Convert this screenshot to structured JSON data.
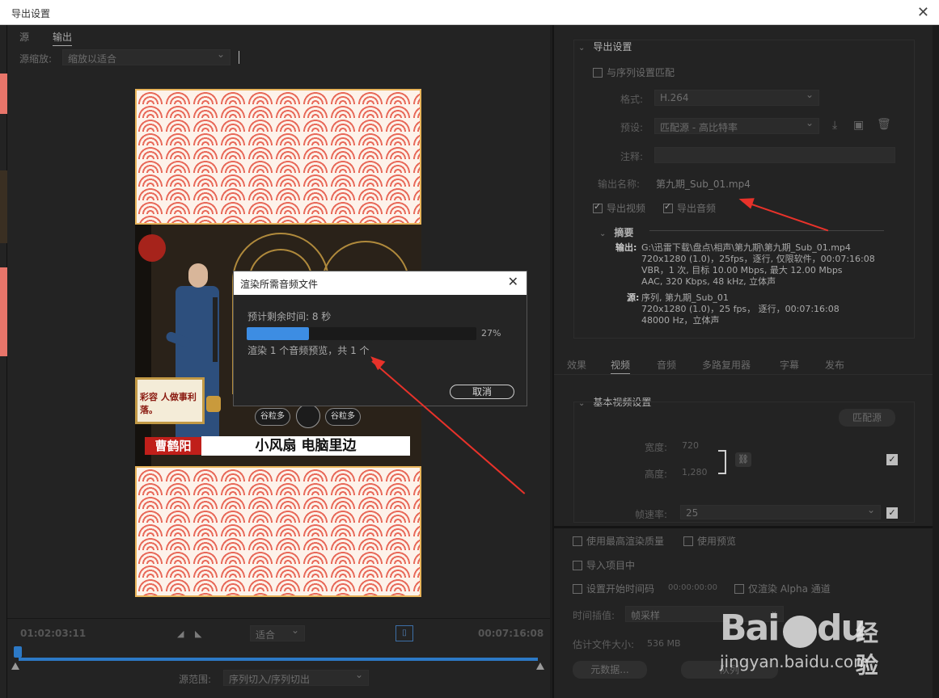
{
  "window": {
    "title": "导出设置",
    "close_glyph": "✕"
  },
  "left": {
    "tabs": [
      "源",
      "输出"
    ],
    "scale_label": "源缩放:",
    "scale_value": "缩放以适合",
    "video": {
      "sign_text": "彩容 人做事利落。",
      "banner_name": "曹鹤阳",
      "banner_title": "小风扇 电脑里边",
      "candy_left": "谷粒多",
      "candy_right": "谷粒多"
    }
  },
  "dialog": {
    "title": "渲染所需音频文件",
    "close_glyph": "✕",
    "remaining": "预计剩余时间: 8 秒",
    "progress": 0.27,
    "progress_label": "27%",
    "message": "渲染 1 个音频预览，共 1 个",
    "cancel": "取消"
  },
  "timeline": {
    "current_tc": "01:02:03:11",
    "end_tc": "00:07:16:08",
    "fit": "适合",
    "range_label": "源范围:",
    "range_value": "序列切入/序列切出"
  },
  "export": {
    "section_title": "导出设置",
    "match_sequence": "与序列设置匹配",
    "format_label": "格式:",
    "format_value": "H.264",
    "preset_label": "预设:",
    "preset_value": "匹配源 - 高比特率",
    "comment_label": "注释:",
    "output_name_label": "输出名称:",
    "output_name_value": "第九期_Sub_01.mp4",
    "export_video": "导出视频",
    "export_audio": "导出音频",
    "summary_title": "摘要",
    "output_label": "输出:",
    "output_lines": [
      "G:\\迅雷下载\\盘点\\相声\\第九期\\第九期_Sub_01.mp4",
      "720x1280 (1.0)，25fps，逐行, 仅限软件，00:07:16:08",
      "VBR，1 次, 目标 10.00 Mbps, 最大 12.00 Mbps",
      "AAC, 320 Kbps, 48  kHz, 立体声"
    ],
    "source_label": "源:",
    "source_lines": [
      "序列, 第九期_Sub_01",
      "720x1280 (1.0)，25 fps， 逐行，00:07:16:08",
      "48000 Hz，立体声"
    ]
  },
  "right_tabs": [
    "效果",
    "视频",
    "音频",
    "多路复用器",
    "字幕",
    "发布"
  ],
  "video_settings": {
    "section_title": "基本视频设置",
    "match_source": "匹配源",
    "width_label": "宽度:",
    "width_value": "720",
    "height_label": "高度:",
    "height_value": "1,280",
    "framerate_label": "帧速率:",
    "framerate_value": "25"
  },
  "bottom": {
    "max_quality": "使用最高渲染质量",
    "use_preview": "使用预览",
    "import_project": "导入项目中",
    "set_start_tc": "设置开始时间码",
    "start_tc_value": "00:00:00:00",
    "alpha_only": "仅渲染 Alpha 通道",
    "interp_label": "时间插值:",
    "interp_value": "帧采样",
    "est_size_label": "估计文件大小:",
    "est_size_value": "536 MB",
    "metadata_btn": "元数据...",
    "queue_btn": "队列"
  },
  "watermark": {
    "brand_left": "Bai",
    "brand_right": "du",
    "jingyan": "经验",
    "url": "jingyan.baidu.com"
  },
  "colors": {
    "accent": "#3d8de3",
    "annotation_arrow": "#e8322a",
    "banner_red": "#c01f1a"
  }
}
